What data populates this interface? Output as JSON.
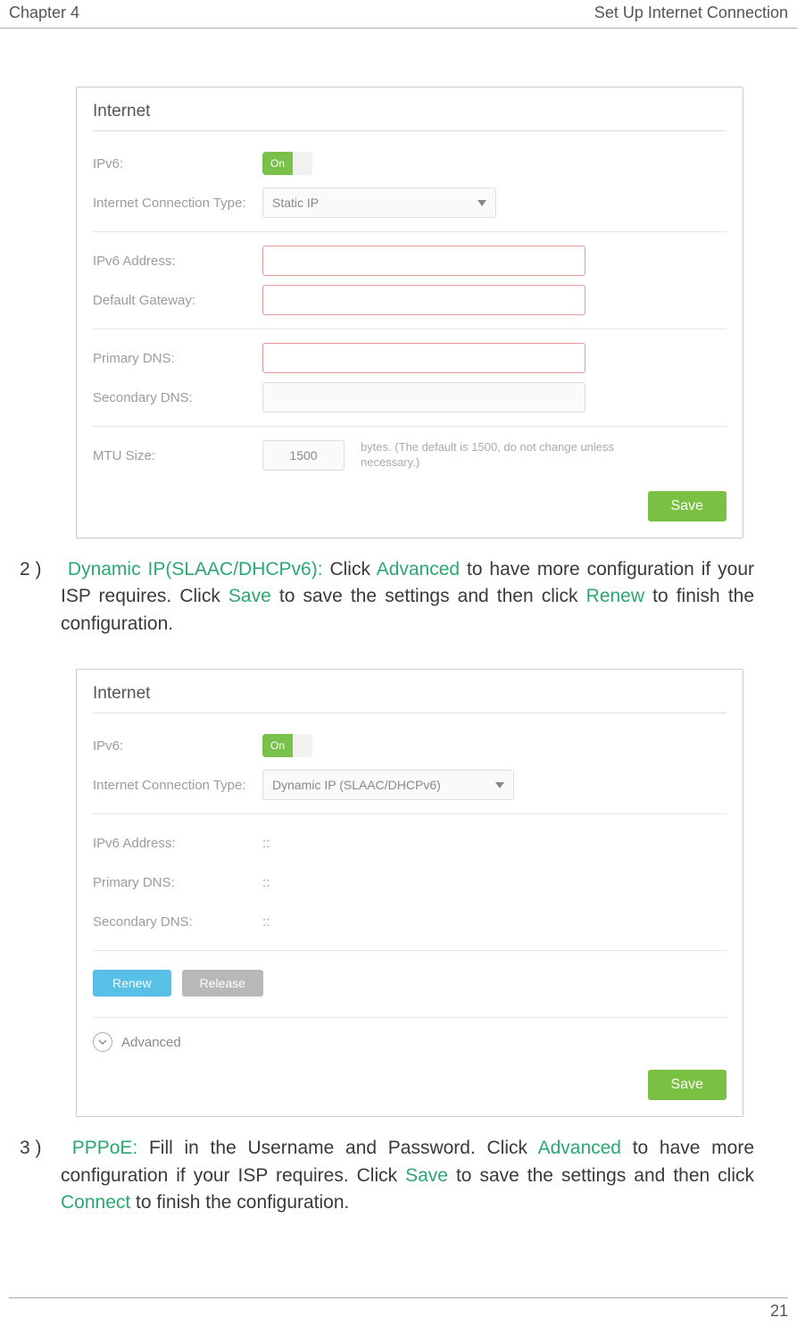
{
  "header": {
    "chapter": "Chapter 4",
    "title": "Set Up Internet Connection"
  },
  "panel1": {
    "title": "Internet",
    "ipv6_label": "IPv6:",
    "ipv6_toggle": "On",
    "conn_label": "Internet Connection Type:",
    "conn_value": "Static IP",
    "addr_label": "IPv6 Address:",
    "gw_label": "Default Gateway:",
    "pdns_label": "Primary DNS:",
    "sdns_label": "Secondary DNS:",
    "mtu_label": "MTU Size:",
    "mtu_value": "1500",
    "mtu_note": "bytes. (The default is 1500, do not change unless necessary.)",
    "save": "Save"
  },
  "para1": {
    "num": "2 )",
    "lead": "Dynamic IP(SLAAC/DHCPv6):",
    "t1": " Click ",
    "adv": "Advanced",
    "t2": " to have more configuration if your ISP requires. Click ",
    "save": "Save",
    "t3": " to save the settings and then click ",
    "renew": "Renew",
    "t4": " to finish the configuration."
  },
  "panel2": {
    "title": "Internet",
    "ipv6_label": "IPv6:",
    "ipv6_toggle": "On",
    "conn_label": "Internet Connection Type:",
    "conn_value": "Dynamic IP (SLAAC/DHCPv6)",
    "addr_label": "IPv6 Address:",
    "addr_value": "::",
    "pdns_label": "Primary DNS:",
    "pdns_value": "::",
    "sdns_label": "Secondary DNS:",
    "sdns_value": "::",
    "renew": "Renew",
    "release": "Release",
    "advanced": "Advanced",
    "save": "Save"
  },
  "para2": {
    "num": "3 )",
    "lead": "PPPoE:",
    "t1": " Fill in the Username and Password. Click ",
    "adv": "Advanced",
    "t2": " to have more configuration if your ISP requires. Click ",
    "save": "Save",
    "t3": " to save the settings and then click ",
    "connect": "Connect",
    "t4": " to finish the configuration."
  },
  "footer": {
    "page": "21"
  }
}
